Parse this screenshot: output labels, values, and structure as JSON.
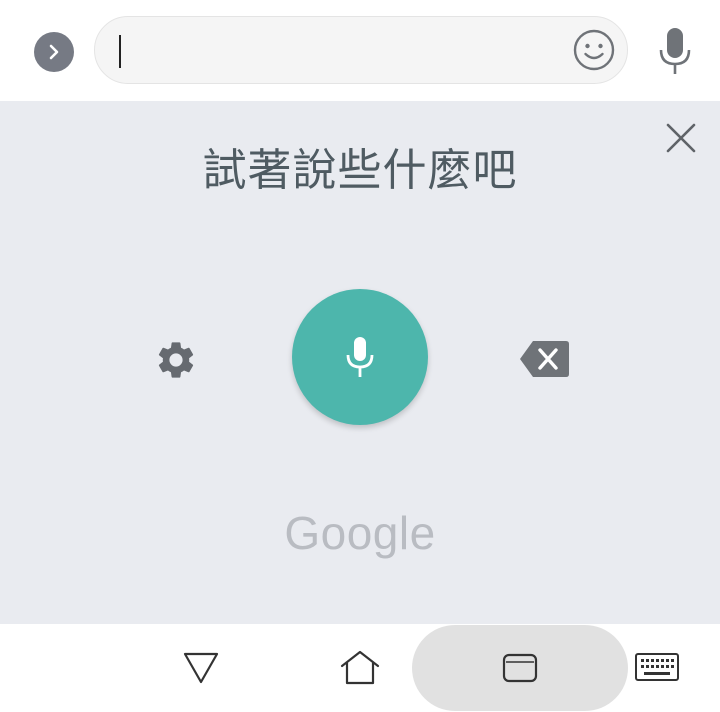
{
  "input": {
    "value": "",
    "expand_icon": "chevron-right-icon",
    "emoji_icon": "smiley-icon",
    "voice_icon": "microphone-icon"
  },
  "voice_panel": {
    "prompt": "試著說些什麼吧",
    "brand": "Google",
    "close_icon": "close-icon",
    "settings_icon": "gear-icon",
    "mic_icon": "microphone-icon",
    "delete_icon": "backspace-icon"
  },
  "nav": {
    "back_icon": "back-triangle-icon",
    "home_icon": "home-icon",
    "recents_icon": "recents-icon",
    "keyboard_icon": "keyboard-icon"
  },
  "colors": {
    "mic_button": "#4db6ac",
    "panel_bg": "#e9ebf0",
    "prompt_text": "#4f5b62",
    "icon_gray": "#6f7378"
  }
}
